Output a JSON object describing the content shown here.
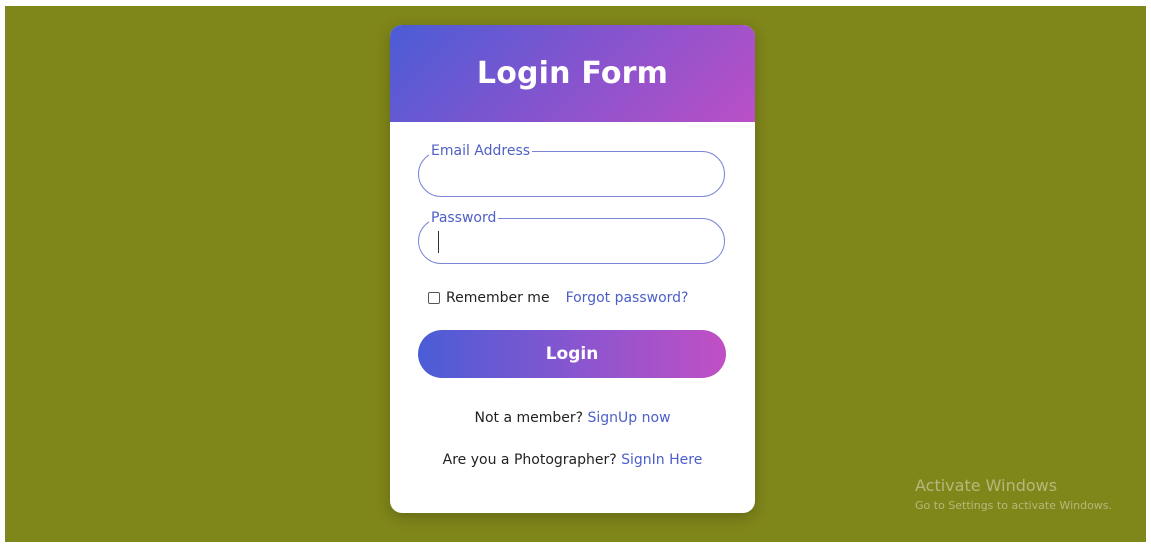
{
  "form": {
    "title": "Login Form",
    "email": {
      "label": "Email Address",
      "value": ""
    },
    "password": {
      "label": "Password",
      "value": ""
    },
    "remember_label": "Remember me",
    "forgot_link": "Forgot password?",
    "login_label": "Login",
    "signup_prompt": "Not a member?",
    "signup_link": "SignUp now",
    "photographer_prompt": "Are you a Photographer?",
    "photographer_link": "SignIn Here"
  },
  "watermark": {
    "title": "Activate Windows",
    "subtitle": "Go to Settings to activate Windows."
  },
  "colors": {
    "background": "#7f861a",
    "gradient_start": "#4a5dd6",
    "gradient_end": "#c14fc4",
    "link": "#4c5fc9"
  }
}
